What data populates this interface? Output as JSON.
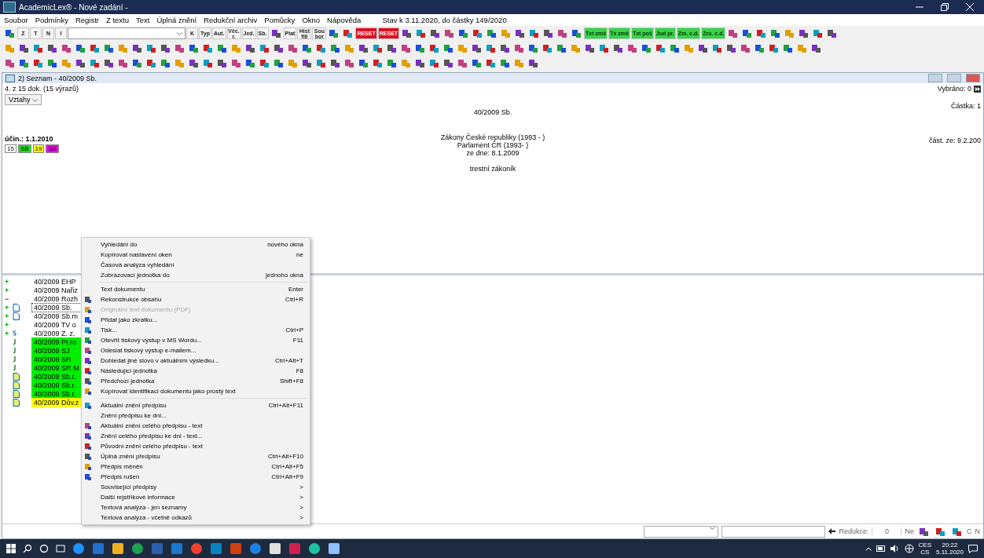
{
  "window": {
    "title": "AcademicLex® - Nové zadání -"
  },
  "menu_bar": [
    "Soubor",
    "Podmínky",
    "Registr",
    "Z textu",
    "Text",
    "Úplná znění",
    "Redukční archiv",
    "Pomůcky",
    "Okno",
    "Nápověda"
  ],
  "status_note": "Stav k 3.11.2020, do částky 149/2020",
  "toolbar": [
    {
      "kind": "icon"
    },
    {
      "kind": "text",
      "label": "Z"
    },
    {
      "kind": "text",
      "label": "T"
    },
    {
      "kind": "text",
      "label": "N"
    },
    {
      "kind": "text",
      "label": "I"
    },
    {
      "kind": "combo"
    },
    {
      "kind": "text",
      "label": "K"
    },
    {
      "kind": "text",
      "label": "Typ"
    },
    {
      "kind": "text",
      "label": "Aut."
    },
    {
      "kind": "text",
      "label": "Věc. r."
    },
    {
      "kind": "text",
      "label": "Jed."
    },
    {
      "kind": "text",
      "label": "Sb."
    },
    {
      "kind": "icon"
    },
    {
      "kind": "text",
      "label": "Plat"
    },
    {
      "kind": "text",
      "label": "Hist fill"
    },
    {
      "kind": "text",
      "label": "Sou bor"
    },
    {
      "kind": "icon"
    },
    {
      "kind": "icon"
    },
    {
      "kind": "alert",
      "label": "RESET"
    },
    {
      "kind": "alert",
      "label": "RESET"
    },
    {
      "kind": "icon"
    },
    {
      "kind": "icon"
    },
    {
      "kind": "icon"
    },
    {
      "kind": "icon"
    },
    {
      "kind": "icon"
    },
    {
      "kind": "icon"
    },
    {
      "kind": "icon"
    },
    {
      "kind": "icon"
    },
    {
      "kind": "icon"
    },
    {
      "kind": "icon"
    },
    {
      "kind": "icon"
    },
    {
      "kind": "icon"
    },
    {
      "kind": "icon"
    },
    {
      "kind": "green",
      "label": "Txt zmš"
    },
    {
      "kind": "green",
      "label": "Tx zmš"
    },
    {
      "kind": "green",
      "label": "Txt poš"
    },
    {
      "kind": "green",
      "label": "Jud pr."
    },
    {
      "kind": "green",
      "label": "Zm. c.d."
    },
    {
      "kind": "green",
      "label": "Zru. c.d."
    },
    {
      "kind": "icon"
    },
    {
      "kind": "icon"
    },
    {
      "kind": "icon"
    },
    {
      "kind": "icon"
    },
    {
      "kind": "icon"
    },
    {
      "kind": "icon"
    },
    {
      "kind": "icon"
    },
    {
      "kind": "icon"
    }
  ],
  "document_window": {
    "title": "2) Seznam - 40/2009 Sb.",
    "count": "4. z 15 dok. (15 výrazů)",
    "relations_dropdown": "Vztahy",
    "effective": "účin.: 1.1.2010",
    "badges": [
      {
        "label": "15",
        "color": "#ffffff"
      },
      {
        "label": "SB",
        "color": "#22dd22"
      },
      {
        "label": "19",
        "color": "#ffff00"
      },
      {
        "label": "SB",
        "color": "#ee00ee"
      }
    ],
    "heading": "40/2009 Sb.",
    "source_lines": [
      "Zákony České republiky (1993 -   )",
      "Parlament ČR (1993-   )",
      "ze dne: 8.1.2009"
    ],
    "subject": "trestní zákoník",
    "selected_count": "Vybráno: 0",
    "issue": "Částka: 1",
    "issue_date": "část. ze: 9.2.200"
  },
  "documents": [
    {
      "kind": "plus",
      "marker": "+",
      "label": "40/2009 EHP",
      "selected": false
    },
    {
      "kind": "plus",
      "marker": "+",
      "label": "40/2009 Nařiz",
      "selected": false
    },
    {
      "kind": "minus",
      "marker": "−",
      "label": "40/2009 Rozh",
      "selected": false
    },
    {
      "kind": "plus-doc",
      "marker": "+",
      "label": "40/2009 Sb.",
      "selected": true
    },
    {
      "kind": "plus-doc",
      "marker": "+",
      "label": "40/2009 Sb.m",
      "selected": false
    },
    {
      "kind": "plus",
      "marker": "+",
      "label": "40/2009 TV o",
      "selected": false
    },
    {
      "kind": "plus-small",
      "marker": "+",
      "label": "40/2009 Z. z.",
      "selected": false
    },
    {
      "kind": "j",
      "label": "40/2009 Pr.ro",
      "selected": false,
      "color": "#00ee00"
    },
    {
      "kind": "j",
      "label": "40/2009 SJ",
      "selected": false,
      "color": "#00ee00"
    },
    {
      "kind": "j",
      "label": "40/2009 SR",
      "selected": false,
      "color": "#00ee00"
    },
    {
      "kind": "j",
      "label": "40/2009 SR M",
      "selected": false,
      "color": "#00ee00"
    },
    {
      "kind": "doc",
      "label": "40/2009 Sb.r.",
      "selected": false,
      "color": "#00ee00"
    },
    {
      "kind": "doc",
      "label": "40/2009 Sb.r.",
      "selected": false,
      "color": "#00ee00"
    },
    {
      "kind": "doc",
      "label": "40/2009 Sb.r.",
      "selected": false,
      "color": "#00ee00"
    },
    {
      "kind": "doc",
      "label": "40/2009 Dův.z",
      "selected": false,
      "color": "#ffff00"
    }
  ],
  "context_menu": [
    {
      "kind": "item",
      "label": "Vyhledání do",
      "shortcut": "nového okna",
      "icon": false,
      "disabled": false
    },
    {
      "kind": "item",
      "label": "Kopírovat nastavení oken",
      "shortcut": "ne",
      "icon": false,
      "disabled": false
    },
    {
      "kind": "item",
      "label": "Časová analýza vyhledání",
      "icon": false,
      "disabled": false
    },
    {
      "kind": "item",
      "label": "Zobrazovací jednotka do",
      "shortcut": "jednoho okna",
      "icon": false,
      "disabled": false
    },
    {
      "kind": "separator"
    },
    {
      "kind": "item",
      "label": "Text dokumentu",
      "shortcut": "Enter",
      "icon": false,
      "disabled": false
    },
    {
      "kind": "item",
      "label": "Rekonstrukce obsahu",
      "shortcut": "Ctrl+R",
      "icon": true,
      "disabled": false
    },
    {
      "kind": "item",
      "label": "Originální text dokumentu (PDF)",
      "icon": true,
      "disabled": true
    },
    {
      "kind": "item",
      "label": "Přidat jako zkratku...",
      "icon": true,
      "disabled": false
    },
    {
      "kind": "item",
      "label": "Tisk...",
      "shortcut": "Ctrl+P",
      "icon": true,
      "disabled": false
    },
    {
      "kind": "item",
      "label": "Otevřít tiskový výstup v MS Wordu...",
      "shortcut": "F11",
      "icon": true,
      "disabled": false
    },
    {
      "kind": "item",
      "label": "Odeslat tiskový výstup e-mailem...",
      "icon": true,
      "disabled": false
    },
    {
      "kind": "item",
      "label": "Dohledat jiné slovo v aktuálním výsledku...",
      "shortcut": "Ctrl+Alt+T",
      "icon": true,
      "disabled": false
    },
    {
      "kind": "item",
      "label": "Následující jednotka",
      "shortcut": "F8",
      "icon": true,
      "disabled": false
    },
    {
      "kind": "item",
      "label": "Předchozí jednotka",
      "shortcut": "Shift+F8",
      "icon": true,
      "disabled": false
    },
    {
      "kind": "item",
      "label": "Kopírovat identifikaci dokumentu jako prostý text",
      "icon": true,
      "disabled": false
    },
    {
      "kind": "separator"
    },
    {
      "kind": "item",
      "label": "Aktuální znění předpisu",
      "shortcut": "Ctrl+Alt+F11",
      "icon": true,
      "disabled": false
    },
    {
      "kind": "item",
      "label": "Znění předpisu ke dni...",
      "icon": false,
      "disabled": false
    },
    {
      "kind": "item",
      "label": "Aktuální znění celého předpisu - text",
      "icon": true,
      "disabled": false
    },
    {
      "kind": "item",
      "label": "Znění celého předpisu ke dni - text...",
      "icon": true,
      "disabled": false
    },
    {
      "kind": "item",
      "label": "Původní znění celého předpisu - text",
      "icon": true,
      "disabled": false
    },
    {
      "kind": "item",
      "label": "Úplná znění předpisu",
      "shortcut": "Ctrl+Alt+F10",
      "icon": true,
      "disabled": false
    },
    {
      "kind": "item",
      "label": "Předpis měněn",
      "shortcut": "Ctrl+Alt+F5",
      "icon": true,
      "disabled": false
    },
    {
      "kind": "item",
      "label": "Předpis rušen",
      "shortcut": "Ctrl+Alt+F9",
      "icon": true,
      "disabled": false
    },
    {
      "kind": "item",
      "label": "Související předpisy",
      "submenu": ">",
      "icon": false,
      "disabled": false
    },
    {
      "kind": "item",
      "label": "Další rejstříkové informace",
      "submenu": ">",
      "icon": false,
      "disabled": false
    },
    {
      "kind": "item",
      "label": "Textová analýza - jen seznamy",
      "submenu": ">",
      "icon": false,
      "disabled": false
    },
    {
      "kind": "item",
      "label": "Textová analýza - včetně odkazů",
      "submenu": ">",
      "icon": false,
      "disabled": false
    }
  ],
  "status_bar": {
    "reduction_label": "Redukce:",
    "reduction_value": "0",
    "answer": "Ne",
    "flags": [
      "C",
      "N"
    ]
  },
  "taskbar": {
    "language_top": "CES",
    "language_bottom": "CS",
    "time": "20:22",
    "date": "5.11.2020"
  }
}
